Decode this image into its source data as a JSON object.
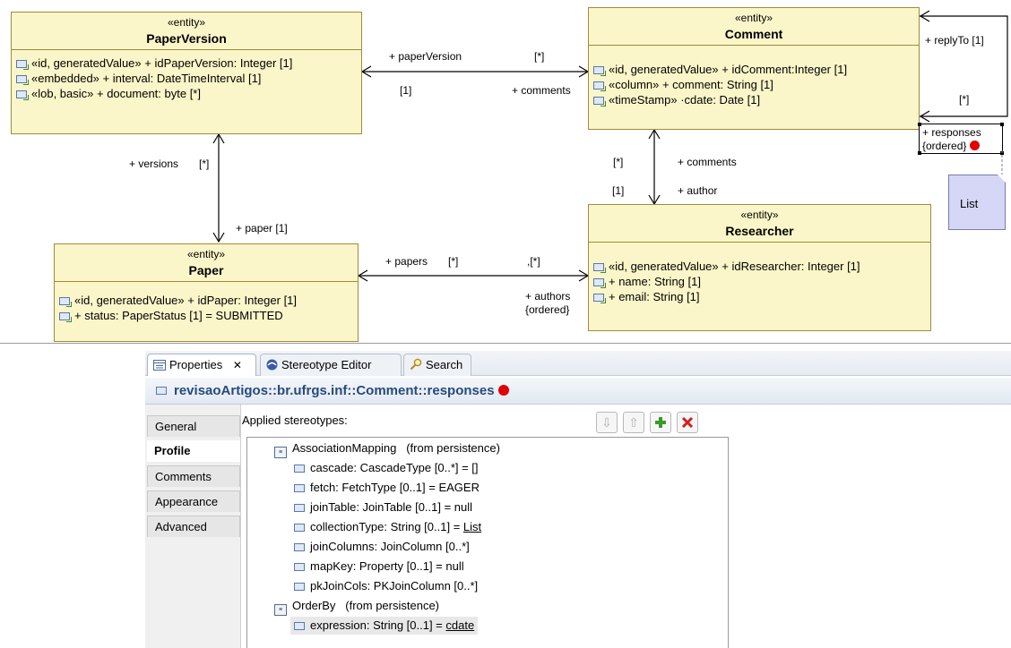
{
  "diagram": {
    "classes": {
      "paperversion": {
        "stereotype": "«entity»",
        "name": "PaperVersion",
        "attrs": [
          "«id, generatedValue» + idPaperVersion: Integer [1]",
          "«embedded» + interval: DateTimeInterval [1]",
          "«lob, basic» + document: byte [*]"
        ]
      },
      "comment": {
        "stereotype": "«entity»",
        "name": "Comment",
        "attrs": [
          "«id, generatedValue» + idComment:Integer [1]",
          "«column» + comment: String [1]",
          "«timeStamp» ·cdate: Date [1]"
        ]
      },
      "paper": {
        "stereotype": "«entity»",
        "name": "Paper",
        "attrs": [
          "«id, generatedValue» + idPaper: Integer [1]",
          "+ status: PaperStatus [1] = SUBMITTED"
        ]
      },
      "researcher": {
        "stereotype": "«entity»",
        "name": "Researcher",
        "attrs": [
          "«id, generatedValue» + idResearcher: Integer [1]",
          "+ name: String [1]",
          "+ email: String [1]"
        ]
      }
    },
    "labels": {
      "pv_paperversion": "+ paperVersion",
      "pv_mult_star": "[*]",
      "pv_mult_one": "[1]",
      "pv_comments": "+ comments",
      "reply_to": "+ replyTo [1]",
      "reply_star": "[*]",
      "responses": "+ responses",
      "ordered1": "{ordered}",
      "versions": "+ versions",
      "versions_mult": "[*]",
      "paper_one": "+ paper [1]",
      "cr_star": "[*]",
      "cr_comments": "+ comments",
      "cr_one": "[1]",
      "cr_author": "+ author",
      "papers": "+ papers",
      "papers_mult": "[*]",
      "authors_mult": ",[*]",
      "authors": "+ authors",
      "ordered2": "{ordered}"
    },
    "note": "List"
  },
  "properties_view": {
    "tabs": [
      "Properties",
      "Stereotype Editor",
      "Search"
    ],
    "title": "revisaoArtigos::br.ufrgs.inf::Comment::responses",
    "sidebar": [
      "General",
      "Profile",
      "Comments",
      "Appearance",
      "Advanced"
    ],
    "applied_label": "Applied stereotypes:",
    "tree": {
      "mapping_name": "AssociationMapping",
      "mapping_from": "(from persistence)",
      "mapping_props": [
        "cascade: CascadeType [0..*] = []",
        "fetch: FetchType [0..1] = EAGER",
        "joinTable: JoinTable [0..1] = null",
        "collectionType: String [0..1] = ",
        "joinColumns: JoinColumn [0..*]",
        "mapKey: Property [0..1] = null",
        "pkJoinCols: PKJoinColumn [0..*]"
      ],
      "collection_value": "List",
      "orderby_name": "OrderBy",
      "orderby_from": "(from persistence)",
      "orderby_prop": "expression: String [0..1] = ",
      "orderby_value": "cdate"
    }
  },
  "colors": {
    "class_fill": "#fbf6c9",
    "class_border": "#a08a3a",
    "note_fill": "#d6d6f6",
    "error_dot": "#e00000",
    "title_text": "#284a7a"
  }
}
